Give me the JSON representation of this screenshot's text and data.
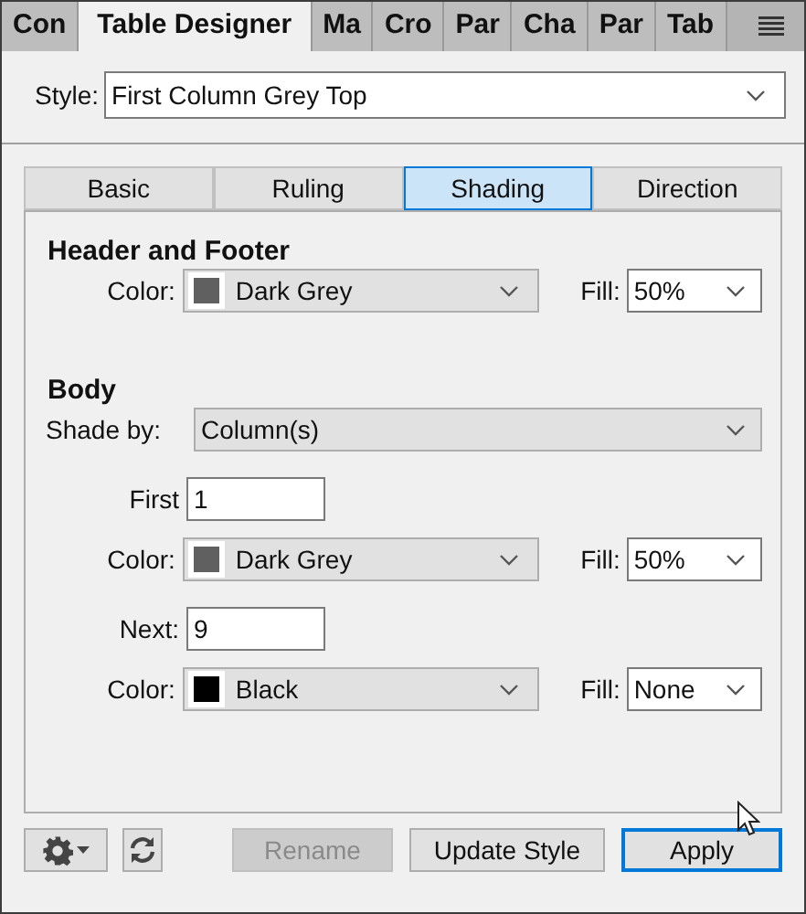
{
  "panel_tabs": [
    {
      "label": "Con",
      "selected": false
    },
    {
      "label": "Table Designer",
      "selected": true
    },
    {
      "label": "Ma",
      "selected": false
    },
    {
      "label": "Cro",
      "selected": false
    },
    {
      "label": "Par",
      "selected": false
    },
    {
      "label": "Cha",
      "selected": false
    },
    {
      "label": "Par",
      "selected": false
    },
    {
      "label": "Tab",
      "selected": false
    }
  ],
  "style": {
    "label": "Style:",
    "value": "First Column Grey Top"
  },
  "tabs": [
    {
      "label": "Basic",
      "selected": false
    },
    {
      "label": "Ruling",
      "selected": false
    },
    {
      "label": "Shading",
      "selected": true
    },
    {
      "label": "Direction",
      "selected": false
    }
  ],
  "header_footer": {
    "title": "Header and Footer",
    "color_label": "Color:",
    "color": {
      "value": "Dark Grey",
      "color": "#606060"
    },
    "fill_label": "Fill:",
    "fill": "50%"
  },
  "body": {
    "title": "Body",
    "shade_by_label": "Shade by:",
    "shade_by": "Column(s)",
    "groups": [
      {
        "count_label": "First",
        "count": "1",
        "color_label": "Color:",
        "color": {
          "value": "Dark Grey",
          "color": "#606060"
        },
        "fill_label": "Fill:",
        "fill": "50%"
      },
      {
        "count_label": "Next:",
        "count": "9",
        "color_label": "Color:",
        "color": {
          "value": "Black",
          "color": "#000000"
        },
        "fill_label": "Fill:",
        "fill": "None"
      }
    ]
  },
  "buttons": [
    {
      "label": "Rename",
      "disabled": true,
      "default": false
    },
    {
      "label": "Update Style",
      "disabled": false,
      "default": false
    },
    {
      "label": "Apply",
      "disabled": false,
      "default": true
    }
  ]
}
